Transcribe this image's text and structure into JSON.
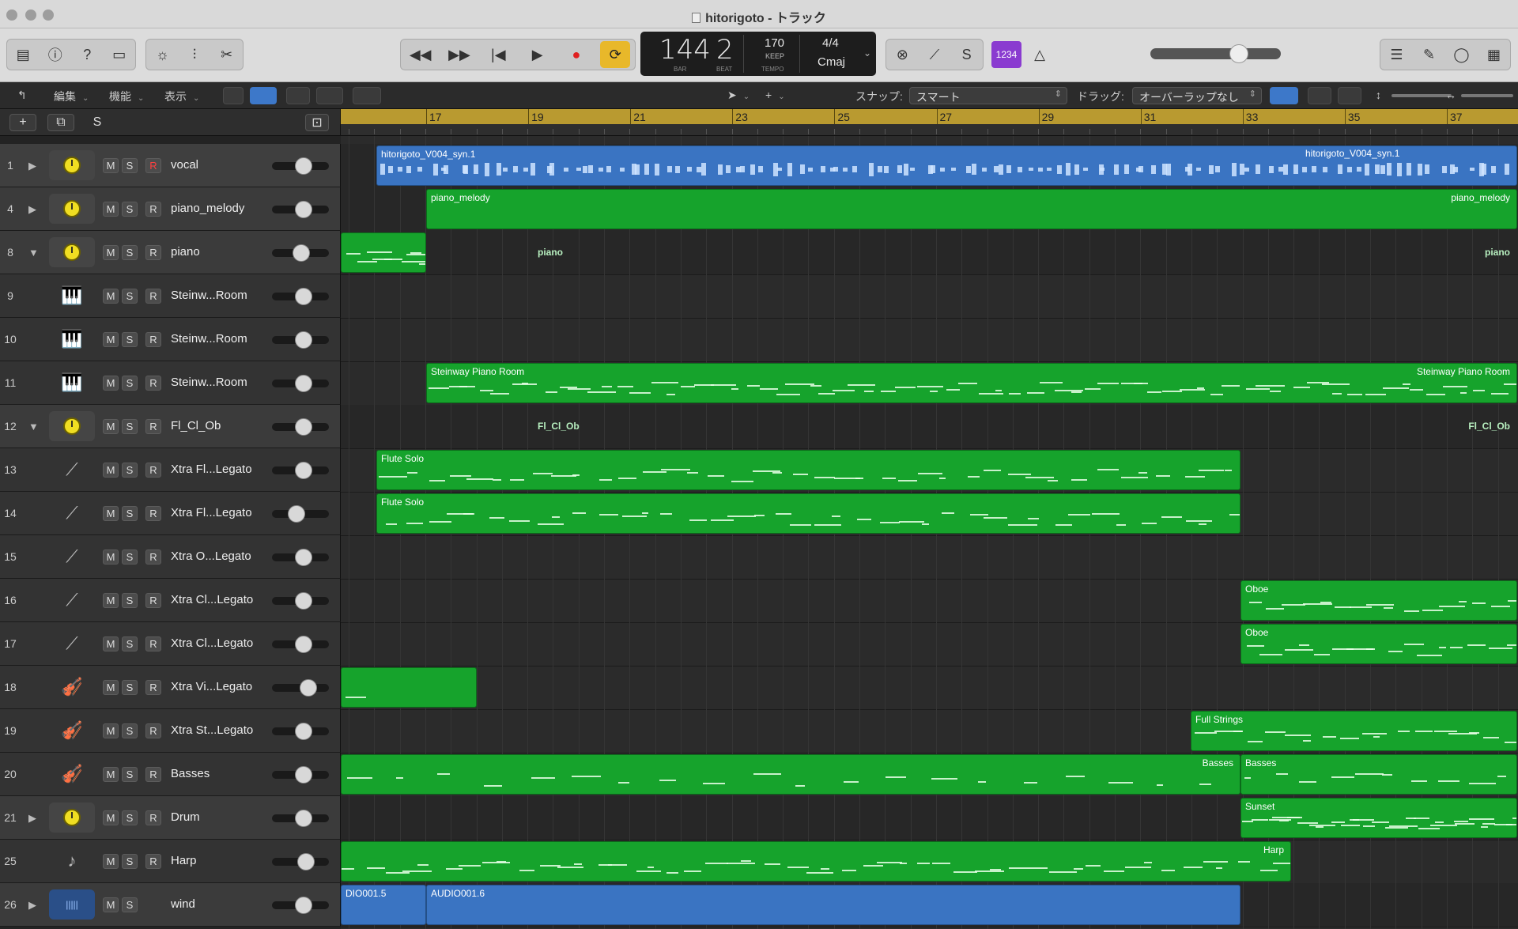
{
  "window": {
    "title": "hitorigoto - トラック"
  },
  "lcd": {
    "bar": "144",
    "beat": "2",
    "bar_label": "BAR",
    "beat_label": "BEAT",
    "tempo": "170",
    "keep": "KEEP",
    "tempo_label": "TEMPO",
    "signature": "4/4",
    "key": "Cmaj"
  },
  "count_in": "1234",
  "editbar": {
    "edit": "編集",
    "functions": "機能",
    "view": "表示",
    "snap_label": "スナップ:",
    "snap_value": "スマート",
    "drag_label": "ドラッグ:",
    "drag_value": "オーバーラップなし"
  },
  "header": {
    "add": "+",
    "solo": "S"
  },
  "ruler": [
    "17",
    "19",
    "21",
    "23",
    "25",
    "27",
    "29",
    "31",
    "33",
    "35",
    "37"
  ],
  "tracks": [
    {
      "num": "1",
      "name": "vocal",
      "type": "audio",
      "disclosure": "▶",
      "r": true
    },
    {
      "num": "4",
      "name": "piano_melody",
      "type": "stack",
      "disclosure": "▶",
      "r": true
    },
    {
      "num": "8",
      "name": "piano",
      "type": "stack",
      "disclosure": "▼",
      "r": true
    },
    {
      "num": "9",
      "name": "Steinw...Room",
      "type": "piano",
      "disclosure": "",
      "r": true
    },
    {
      "num": "10",
      "name": "Steinw...Room",
      "type": "piano",
      "disclosure": "",
      "r": true
    },
    {
      "num": "11",
      "name": "Steinw...Room",
      "type": "piano",
      "disclosure": "",
      "r": true
    },
    {
      "num": "12",
      "name": "Fl_Cl_Ob",
      "type": "stack",
      "disclosure": "▼",
      "r": true
    },
    {
      "num": "13",
      "name": "Xtra Fl...Legato",
      "type": "flute",
      "disclosure": "",
      "r": true
    },
    {
      "num": "14",
      "name": "Xtra Fl...Legato",
      "type": "flute",
      "disclosure": "",
      "r": true
    },
    {
      "num": "15",
      "name": "Xtra O...Legato",
      "type": "oboe",
      "disclosure": "",
      "r": true
    },
    {
      "num": "16",
      "name": "Xtra Cl...Legato",
      "type": "oboe",
      "disclosure": "",
      "r": true
    },
    {
      "num": "17",
      "name": "Xtra Cl...Legato",
      "type": "oboe",
      "disclosure": "",
      "r": true
    },
    {
      "num": "18",
      "name": "Xtra Vi...Legato",
      "type": "violin",
      "disclosure": "",
      "r": true
    },
    {
      "num": "19",
      "name": "Xtra St...Legato",
      "type": "violin",
      "disclosure": "",
      "r": true
    },
    {
      "num": "20",
      "name": "Basses",
      "type": "cello",
      "disclosure": "",
      "r": true
    },
    {
      "num": "21",
      "name": "Drum",
      "type": "stack",
      "disclosure": "▶",
      "r": true
    },
    {
      "num": "25",
      "name": "Harp",
      "type": "harp",
      "disclosure": "",
      "r": true
    },
    {
      "num": "26",
      "name": "wind",
      "type": "wave",
      "disclosure": "▶",
      "r": false
    }
  ],
  "volumes": [
    0.55,
    0.55,
    0.5,
    0.55,
    0.55,
    0.55,
    0.55,
    0.55,
    0.38,
    0.55,
    0.55,
    0.55,
    0.68,
    0.55,
    0.55,
    0.55,
    0.62,
    0.55
  ],
  "regions": {
    "vocal_a": "hitorigoto_V004_syn.1",
    "vocal_b": "hitorigoto_V004_syn.1",
    "piano_melody_a": "piano_melody",
    "piano_melody_b": "piano_melody",
    "piano_folder_a": "piano",
    "piano_folder_b": "piano",
    "steinway_a": "Steinway Piano Room",
    "steinway_b": "Steinway Piano Room",
    "flclob_a": "Fl_Cl_Ob",
    "flclob_b": "Fl_Cl_Ob",
    "flute1": "Flute Solo",
    "flute2": "Flute Solo",
    "oboe1": "Oboe",
    "oboe2": "Oboe",
    "full_strings": "Full Strings",
    "basses_a": "Basses",
    "basses_b": "Basses",
    "sunset": "Sunset",
    "harp": "Harp",
    "audio_a": "DIO001.5",
    "audio_b": "AUDIO001.6"
  }
}
